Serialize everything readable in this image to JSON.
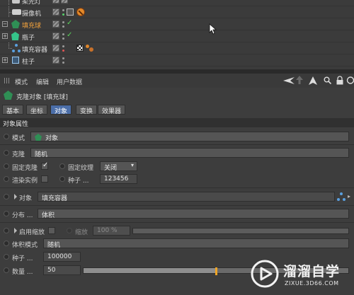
{
  "object_manager": {
    "rows": [
      {
        "name": "柔光灯"
      },
      {
        "name": "摄像机"
      },
      {
        "name": "填充球"
      },
      {
        "name": "瓶子"
      },
      {
        "name": "填充容器"
      },
      {
        "name": "柱子"
      }
    ]
  },
  "attr_menu": {
    "items": [
      "模式",
      "编辑",
      "用户数据"
    ]
  },
  "attr_title": "克隆对象 [填充球]",
  "tabs": [
    "基本",
    "坐标",
    "对象",
    "变换",
    "效果器"
  ],
  "active_tab": "对象",
  "section_header": "对象属性",
  "props": {
    "mode_label": "模式",
    "mode_value": "对象",
    "clone_label": "克隆",
    "clone_value": "随机",
    "fixed_clone_label": "固定克隆",
    "fixed_texture_label": "固定纹理",
    "fixed_texture_value": "关闭",
    "render_instance_label": "渲染实例",
    "seed_label": "种子 ...",
    "seed_value": "123456",
    "object_label": "对象",
    "object_value": "填充容器",
    "distribution_label": "分布 ...",
    "distribution_value": "体积",
    "enable_scale_label": "启用缩放",
    "scale_label": "缩放",
    "scale_value": "100 %",
    "volume_mode_label": "体积模式",
    "volume_mode_value": "随机",
    "seed2_label": "种子 ...",
    "seed2_value": "100000",
    "count_label": "数量 ...",
    "count_value": "50",
    "count_fraction": 0.5
  },
  "watermark": {
    "brand": "溜溜自学",
    "url": "ZIXUE.3D66.COM"
  },
  "colors": {
    "active_tab": "#4b6ea8",
    "active_object": "#f2a23c",
    "slider_thumb": "#f0a526",
    "check": "#59d35a"
  }
}
